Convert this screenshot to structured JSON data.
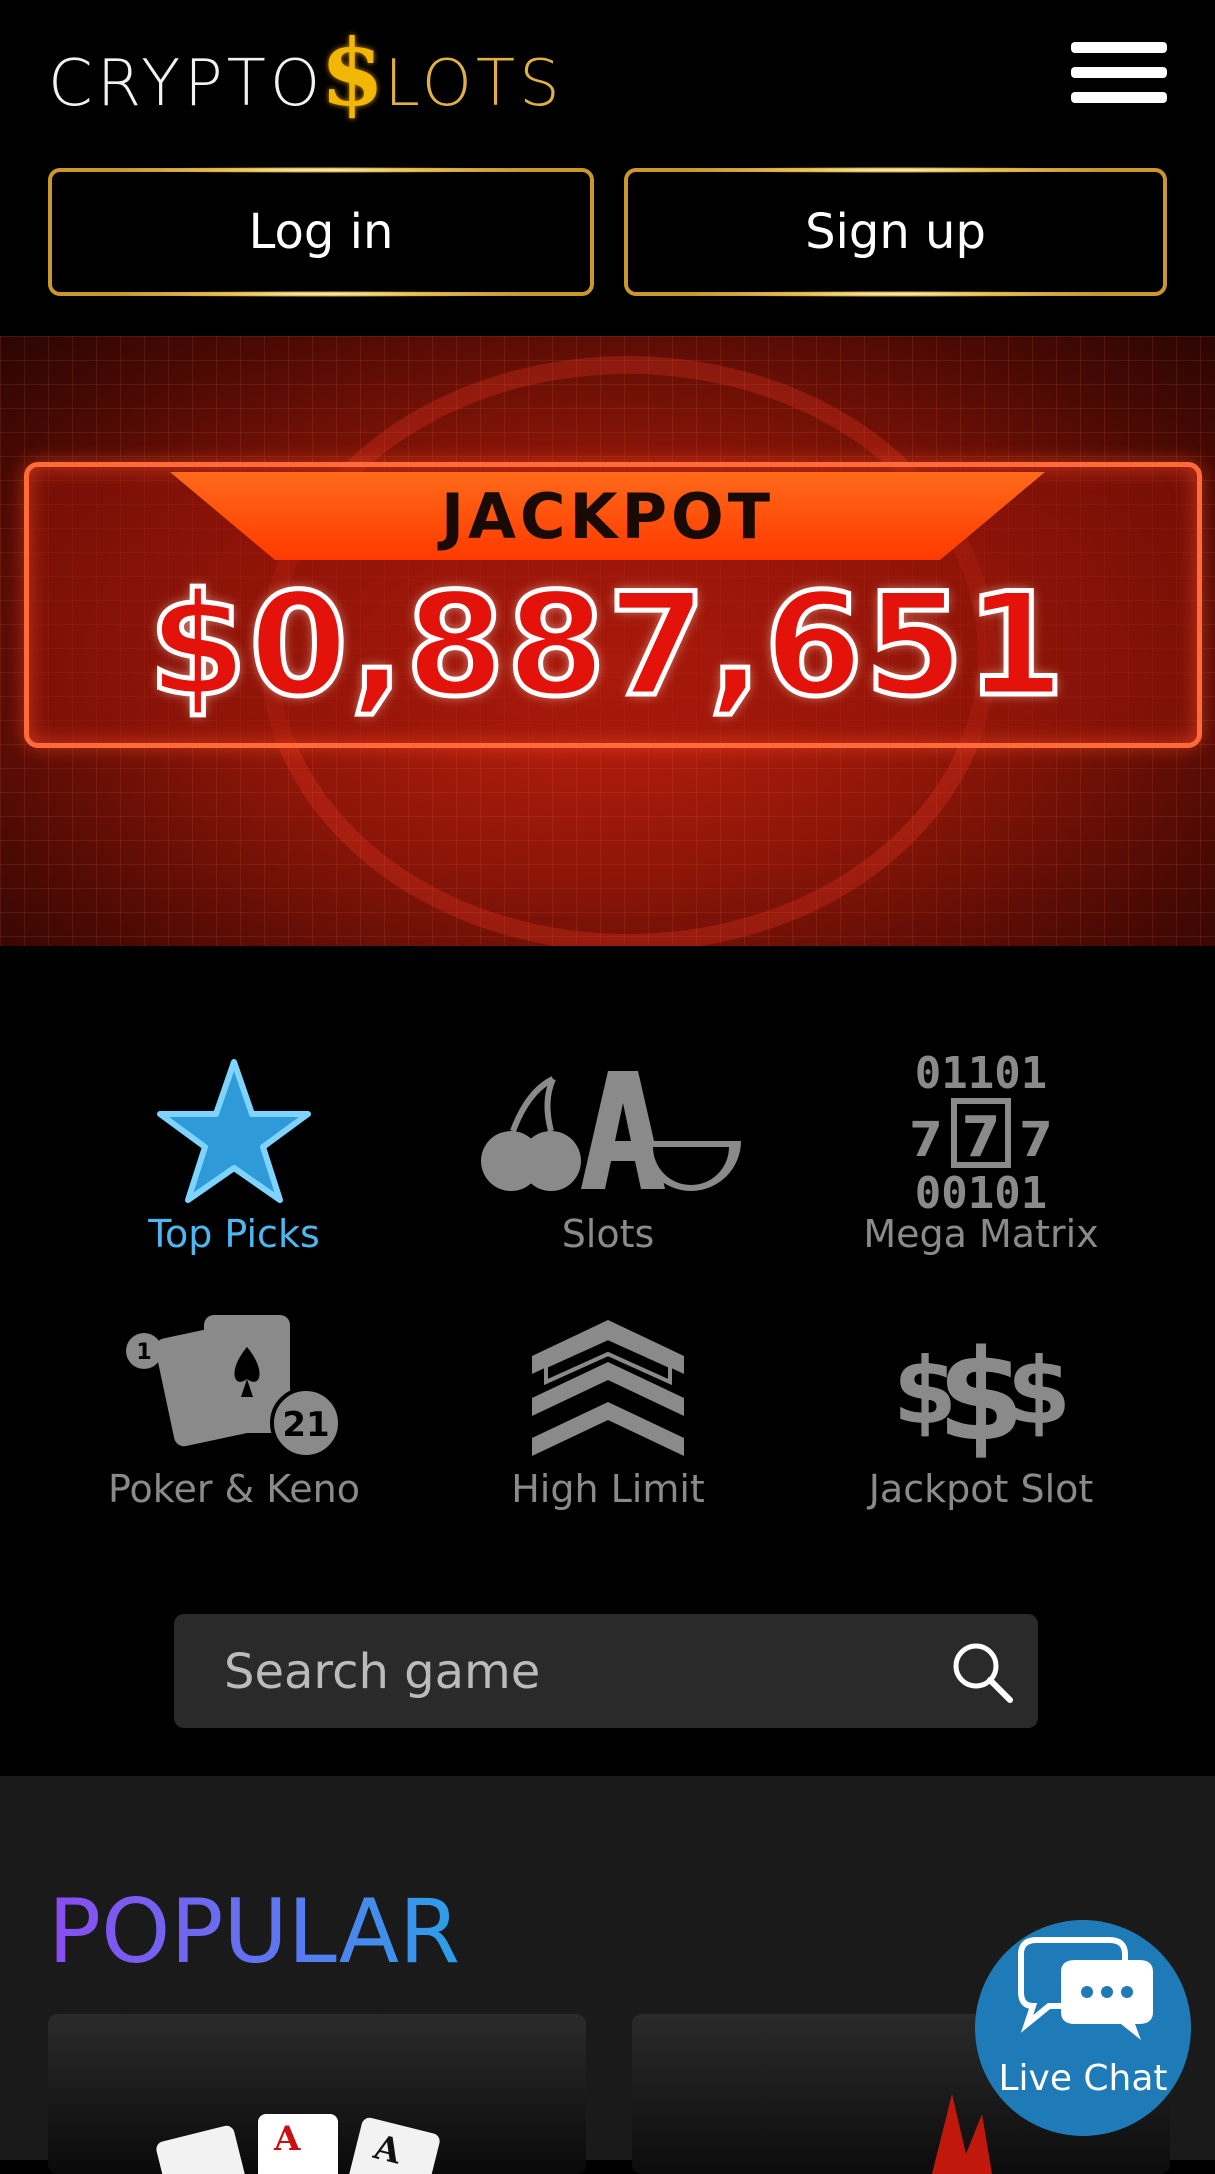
{
  "header": {
    "logo": {
      "part1": "CRYPTO",
      "symbol": "$",
      "part2": "LOTS"
    },
    "menu_icon": "hamburger-menu-icon",
    "login_label": "Log in",
    "signup_label": "Sign up"
  },
  "banner": {
    "label": "JACKPOT",
    "amount": "$0,887,651"
  },
  "categories": [
    {
      "label": "Top Picks",
      "icon": "star-icon",
      "active": true
    },
    {
      "label": "Slots",
      "icon": "slots-fruit-icon",
      "active": false
    },
    {
      "label": "Mega Matrix",
      "icon": "matrix-777-icon",
      "active": false
    },
    {
      "label": "Poker & Keno",
      "icon": "poker-cards-icon",
      "active": false
    },
    {
      "label": "High Limit",
      "icon": "chevron-rank-icon",
      "active": false
    },
    {
      "label": "Jackpot Slot",
      "icon": "dollar-signs-icon",
      "active": false
    }
  ],
  "search": {
    "placeholder": "Search game",
    "icon": "search-icon"
  },
  "popular": {
    "title": "POPULAR"
  },
  "livechat": {
    "label": "Live Chat",
    "icon": "chat-bubble-icon"
  },
  "colors": {
    "accent_gold": "#c8982b",
    "active_blue": "#4db8f0",
    "inactive_gray": "#8a8a8a",
    "chat_blue": "#1f7ab8",
    "jackpot_red": "#e3120b"
  }
}
